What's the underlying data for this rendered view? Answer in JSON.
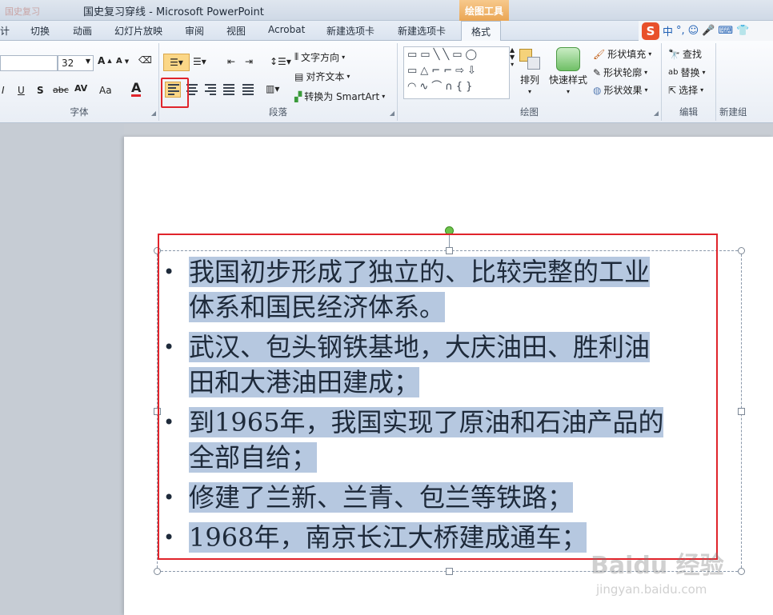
{
  "titlebar": {
    "ghost_text": "国史复习",
    "title": "国史复习穿线 - Microsoft PowerPoint",
    "contextual_tab": "绘图工具"
  },
  "tabs": [
    {
      "label": "计"
    },
    {
      "label": "切换"
    },
    {
      "label": "动画"
    },
    {
      "label": "幻灯片放映"
    },
    {
      "label": "审阅"
    },
    {
      "label": "视图"
    },
    {
      "label": "Acrobat"
    },
    {
      "label": "新建选项卡"
    },
    {
      "label": "新建选项卡"
    },
    {
      "label": "格式"
    }
  ],
  "ime": {
    "logo": "S",
    "lang": "中",
    "punct": "°,",
    "smile": "☺",
    "mic": "🎤",
    "kbd": "⌨",
    "tools": "👕"
  },
  "ribbon": {
    "font": {
      "size": "32",
      "grow": "A",
      "shrink": "A",
      "bold": "I",
      "underline": "U",
      "shadow": "S",
      "strike": "abc",
      "spacing": "AV",
      "case": "Aa",
      "color": "A",
      "group_label": "字体"
    },
    "paragraph": {
      "group_label": "段落",
      "text_direction": "文字方向",
      "align_text": "对齐文本",
      "smartart": "转换为 SmartArt"
    },
    "drawing": {
      "group_label": "绘图",
      "arrange": "排列",
      "quick_styles": "快速样式",
      "shape_fill": "形状填充",
      "shape_outline": "形状轮廓",
      "shape_effects": "形状效果",
      "shapes_rows": [
        [
          "▭",
          "▭",
          "╲",
          "╲",
          "▭",
          "◯"
        ],
        [
          "▭",
          "△",
          "⌐",
          "⌐",
          "⇨",
          "⇩"
        ],
        [
          "◠",
          "∿",
          "⌒",
          "∩",
          "{",
          "}"
        ]
      ]
    },
    "editing": {
      "group_label": "编辑",
      "find": "查找",
      "replace": "替换",
      "select": "选择"
    },
    "newgroup": {
      "group_label": "新建组"
    }
  },
  "slide": {
    "bullets": [
      {
        "lines": [
          "我国初步形成了独立的、比较完整的工业",
          "体系和国民经济体系。"
        ]
      },
      {
        "lines": [
          "武汉、包头钢铁基地，大庆油田、胜利油",
          "田和大港油田建成；"
        ]
      },
      {
        "lines": [
          "到1965年，我国实现了原油和石油产品的",
          "全部自给；"
        ]
      },
      {
        "lines": [
          "修建了兰新、兰青、包兰等铁路；"
        ]
      },
      {
        "lines": [
          "1968年，南京长江大桥建成通车；"
        ]
      }
    ]
  },
  "watermark": {
    "text": "Baidu 经验",
    "url": "jingyan.baidu.com"
  }
}
